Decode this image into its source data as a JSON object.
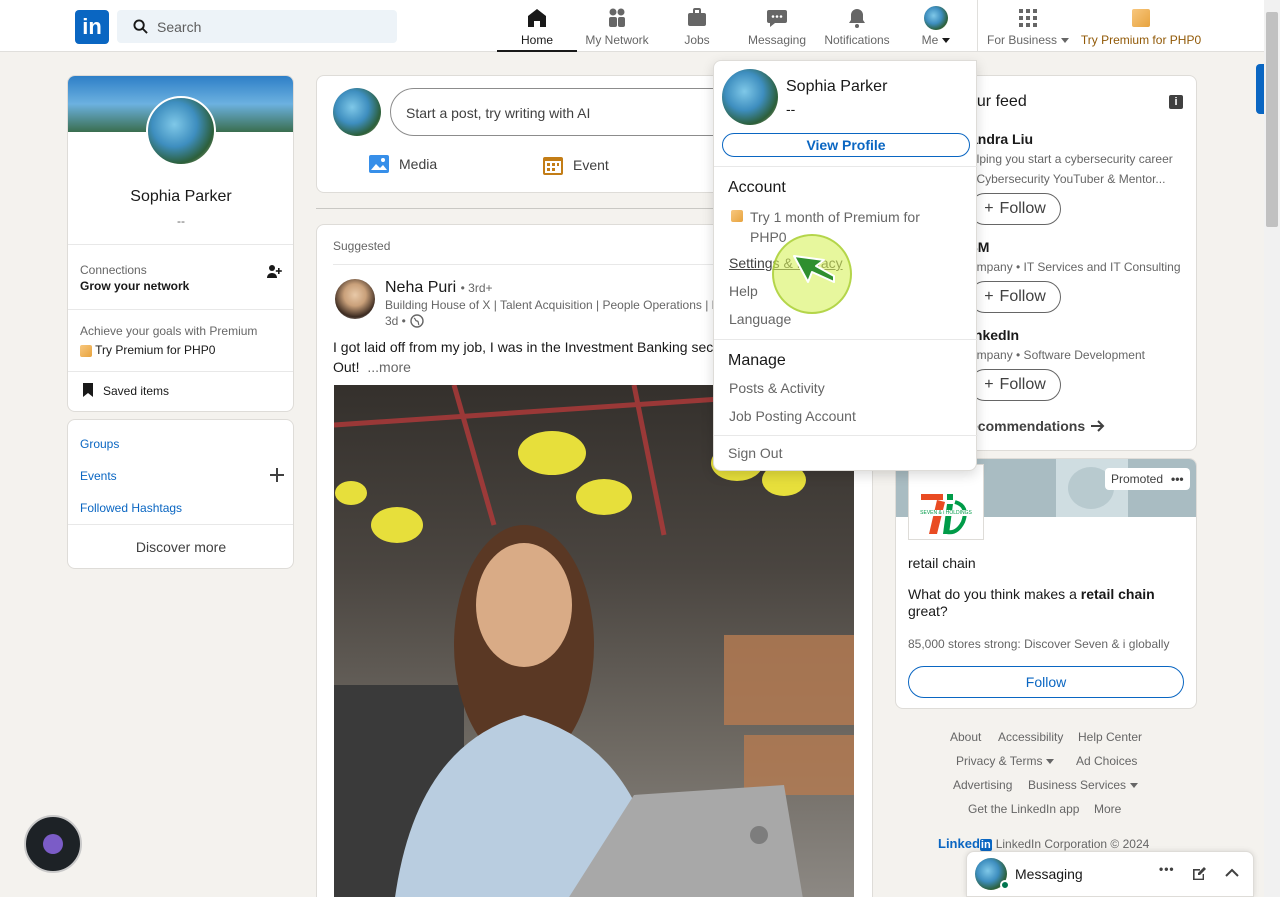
{
  "nav": {
    "search_placeholder": "Search",
    "home": "Home",
    "my_network": "My Network",
    "jobs": "Jobs",
    "messaging": "Messaging",
    "notifications": "Notifications",
    "me": "Me",
    "for_business": "For Business",
    "try_premium": "Try Premium for PHP0"
  },
  "profile_card": {
    "name": "Sophia Parker",
    "headline": "--",
    "connections_title": "Connections",
    "connections_sub": "Grow your network",
    "premium_promo": "Achieve your goals with Premium",
    "premium_link": "Try Premium for PHP0",
    "saved_items": "Saved items"
  },
  "left_links": {
    "groups": "Groups",
    "events": "Events",
    "hashtags": "Followed Hashtags",
    "discover_more": "Discover more"
  },
  "composer": {
    "placeholder": "Start a post, try writing with AI",
    "media": "Media",
    "event": "Event"
  },
  "post": {
    "suggested": "Suggested",
    "author": "Neha Puri",
    "degree": "• 3rd+",
    "headline": "Building House of X | Talent Acquisition | People Operations | H",
    "time": "3d •",
    "text_line1": "I got laid off from my job, I was in the Investment Banking sec",
    "text_line2": "Out!",
    "more": "...more"
  },
  "me_menu": {
    "name": "Sophia Parker",
    "headline": "--",
    "view_profile": "View Profile",
    "account_heading": "Account",
    "premium_offer_line1": "Try 1 month of Premium for",
    "premium_offer_line2": "PHP0",
    "settings": "Settings & Privacy",
    "help": "Help",
    "language": "Language",
    "manage_heading": "Manage",
    "posts_activity": "Posts & Activity",
    "job_posting": "Job Posting Account",
    "sign_out": "Sign Out"
  },
  "feed_suggestions": {
    "title": "our feed",
    "items": [
      {
        "name": "andra Liu",
        "line1": "elping you start a cybersecurity career",
        "line2": "| Cybersecurity YouTuber & Mentor..."
      },
      {
        "name": "3M",
        "line1": "ompany • IT Services and IT Consulting"
      },
      {
        "name": "inkedIn",
        "line1": "ompany • Software Development"
      }
    ],
    "follow": "Follow",
    "recommendations": "ecommendations"
  },
  "ad": {
    "promoted": "Promoted",
    "logo_text": "SEVEN & i HOLDINGS",
    "headline": "retail chain",
    "question_a": "What do you think makes a ",
    "question_b": "retail chain",
    "question_c": "great?",
    "tagline": "85,000 stores strong: Discover Seven & i globally",
    "follow": "Follow"
  },
  "footer": {
    "about": "About",
    "accessibility": "Accessibility",
    "help_center": "Help Center",
    "privacy_terms": "Privacy & Terms",
    "ad_choices": "Ad Choices",
    "advertising": "Advertising",
    "business_services": "Business Services",
    "get_app": "Get the LinkedIn app",
    "more": "More",
    "brand": "Linked",
    "copyright": "LinkedIn Corporation © 2024"
  },
  "messaging_bar": {
    "label": "Messaging"
  },
  "colors": {
    "brand": "#0a66c2",
    "background": "#f4f2ee",
    "cursor_highlight": "#d7f25c"
  }
}
